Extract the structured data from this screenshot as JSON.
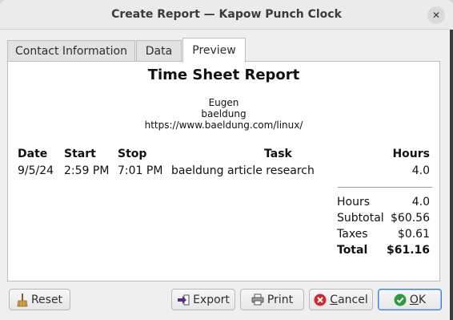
{
  "window": {
    "title": "Create Report — Kapow Punch Clock",
    "close_glyph": "✕"
  },
  "tabs": [
    {
      "label": "Contact Information",
      "active": false
    },
    {
      "label": "Data",
      "active": false
    },
    {
      "label": "Preview",
      "active": true
    }
  ],
  "report": {
    "title": "Time Sheet Report",
    "contact": {
      "name": "Eugen",
      "company": "baeldung",
      "website": "https://www.baeldung.com/linux/"
    },
    "columns": {
      "date": "Date",
      "start": "Start",
      "stop": "Stop",
      "task": "Task",
      "hours": "Hours"
    },
    "rows": [
      {
        "date": "9/5/24",
        "start": "2:59 PM",
        "stop": "7:01 PM",
        "task": "baeldung article research",
        "hours": "4.0"
      }
    ],
    "summary": {
      "hours_label": "Hours",
      "hours_value": "4.0",
      "subtotal_label": "Subtotal",
      "subtotal_value": "$60.56",
      "taxes_label": "Taxes",
      "taxes_value": "$0.61",
      "total_label": "Total",
      "total_value": "$61.16"
    }
  },
  "buttons": {
    "reset": {
      "label": "Reset",
      "icon": "broom-icon"
    },
    "export": {
      "label": "Export",
      "icon": "export-arrow-icon"
    },
    "print": {
      "label": "Print",
      "icon": "printer-icon"
    },
    "cancel": {
      "prefix": "",
      "mnemonic": "C",
      "rest": "ancel",
      "icon": "cancel-icon"
    },
    "ok": {
      "mnemonic": "O",
      "rest": "K",
      "icon": "check-icon"
    }
  },
  "colors": {
    "cancel_icon": "#d7262a",
    "ok_icon": "#2e9b3e",
    "export_icon": "#5a2a82",
    "default_button_border": "#3d7fd1"
  }
}
